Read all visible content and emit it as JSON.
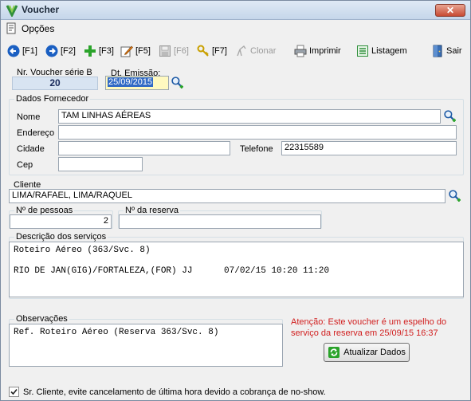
{
  "window": {
    "title": "Voucher",
    "close_glyph": "✕"
  },
  "menu": {
    "options_label": "Opções"
  },
  "toolbar": {
    "f1": "[F1]",
    "f2": "[F2]",
    "f3": "[F3]",
    "f5": "[F5]",
    "f6": "[F6]",
    "f7": "[F7]",
    "clonar": "Clonar",
    "imprimir": "Imprimir",
    "listagem": "Listagem",
    "sair": "Sair"
  },
  "voucher": {
    "label": "Nr. Voucher série B",
    "number": "20"
  },
  "emissao": {
    "label": "Dt. Emissão:",
    "value": "25/09/2015"
  },
  "fornecedor": {
    "legend": "Dados Fornecedor",
    "nome_label": "Nome",
    "nome_value": "TAM LINHAS AÉREAS",
    "endereco_label": "Endereço",
    "endereco_value": "",
    "cidade_label": "Cidade",
    "cidade_value": "",
    "telefone_label": "Telefone",
    "telefone_value": "22315589",
    "cep_label": "Cep",
    "cep_value": ""
  },
  "cliente": {
    "label": "Cliente",
    "value": "LIMA/RAFAEL, LIMA/RAQUEL"
  },
  "pessoas": {
    "label": "Nº de pessoas",
    "value": "2"
  },
  "reserva": {
    "label": "Nº da reserva",
    "value": ""
  },
  "servicos": {
    "legend": "Descrição dos serviços",
    "line1": "Roteiro Aéreo (363/Svc. 8)",
    "line2": "RIO DE JAN(GIG)/FORTALEZA,(FOR) JJ      07/02/15 10:20 11:20"
  },
  "observacoes": {
    "legend": "Observações",
    "value": "Ref. Roteiro Aéreo (Reserva 363/Svc. 8)"
  },
  "atencao": {
    "line1": "Atenção: Este voucher é um espelho do",
    "line2": "serviço da reserva em 25/09/15 16:37"
  },
  "atualizar": {
    "label": "Atualizar Dados"
  },
  "noshow": {
    "label": "Sr. Cliente, evite cancelamento de última hora devido a cobrança de no-show.",
    "checked": true
  },
  "colors": {
    "warning": "#d12020",
    "selection": "#316ac5",
    "highlight": "#fff9c0"
  }
}
